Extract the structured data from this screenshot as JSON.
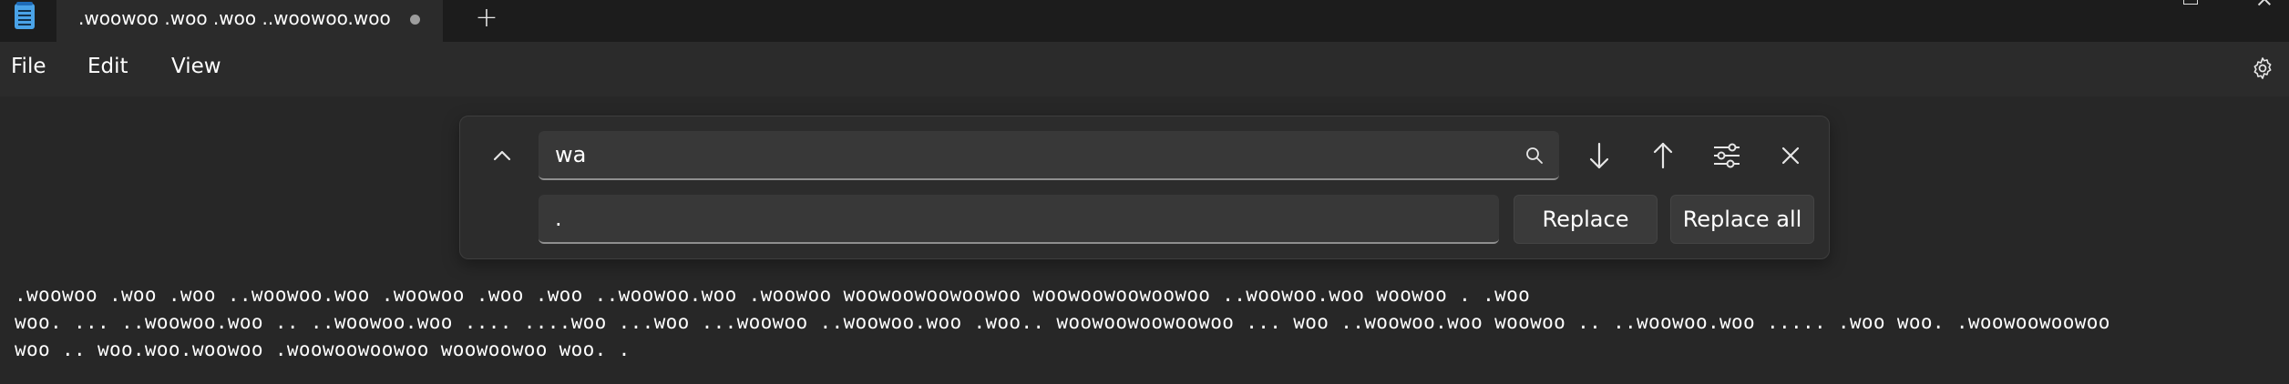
{
  "tab": {
    "title": ".woowoo .woo .woo ..woowoo.woo",
    "unsaved_indicator": "unsaved-dot-icon",
    "new_tab_label": "+"
  },
  "window_controls": {
    "minimize": "minimize-icon",
    "maximize": "maximize-icon",
    "close": "close-icon"
  },
  "menu": {
    "file": "File",
    "edit": "Edit",
    "view": "View",
    "settings_icon": "gear-icon"
  },
  "find_replace": {
    "search_value": "wa",
    "replace_value": ".",
    "replace_label": "Replace",
    "replace_all_label": "Replace all",
    "icons": [
      "chevron-up-icon",
      "search-icon",
      "arrow-down-icon",
      "arrow-up-icon",
      "sliders-icon",
      "close-icon"
    ]
  },
  "editor": {
    "lines": [
      ".woowoo .woo .woo ..woowoo.woo .woowoo .woo .woo ..woowoo.woo .woowoo woowoowoowoowoo woowoowoowoowoo ..woowoo.woo woowoo . .woo",
      "woo. ... ..woowoo.woo .. ..woowoo.woo .... ....woo ...woo ...woowoo ..woowoo.woo .woo.. woowoowoowoowoo ... woo ..woowoo.woo woowoo .. ..woowoo.woo ..... .woo woo. .woowoowoowoo",
      "woo .. woo.woo.woowoo .woowoowoowoo woowoowoo woo. ."
    ]
  },
  "colors": {
    "background": "#272727",
    "titlebar": "#1c1c1c",
    "menubar": "#2b2b2b",
    "panel": "#2c2c2c",
    "field": "#383838",
    "app_icon": "#4aa3e8"
  }
}
